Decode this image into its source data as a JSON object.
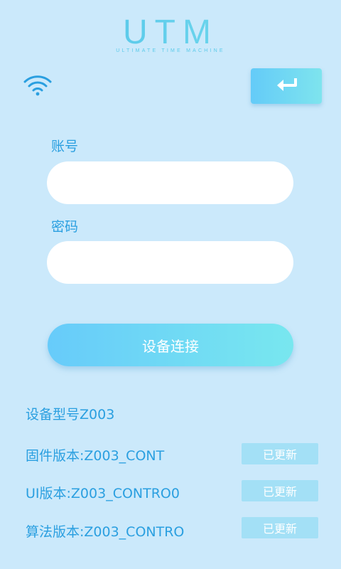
{
  "header": {
    "logo_text": "UTM",
    "logo_tagline": "ULTIMATE TIME MACHINE",
    "wifi_icon": "wifi-icon",
    "back_icon": "return-arrow-icon"
  },
  "form": {
    "account_label": "账号",
    "account_value": "",
    "password_label": "密码",
    "password_value": "",
    "connect_label": "设备连接"
  },
  "device": {
    "model": "设备型号Z003",
    "rows": [
      {
        "text": "固件版本:Z003_CONT",
        "status": "已更新"
      },
      {
        "text": "UI版本:Z003_CONTRO0",
        "status": "已更新"
      },
      {
        "text": "算法版本:Z003_CONTRO",
        "status": "已更新"
      }
    ]
  },
  "colors": {
    "background": "#cbe9fb",
    "accent_text": "#2a9fe0",
    "button_gradient_start": "#67cbfa",
    "button_gradient_end": "#78e7ef",
    "status_badge": "#a3e0f6"
  }
}
